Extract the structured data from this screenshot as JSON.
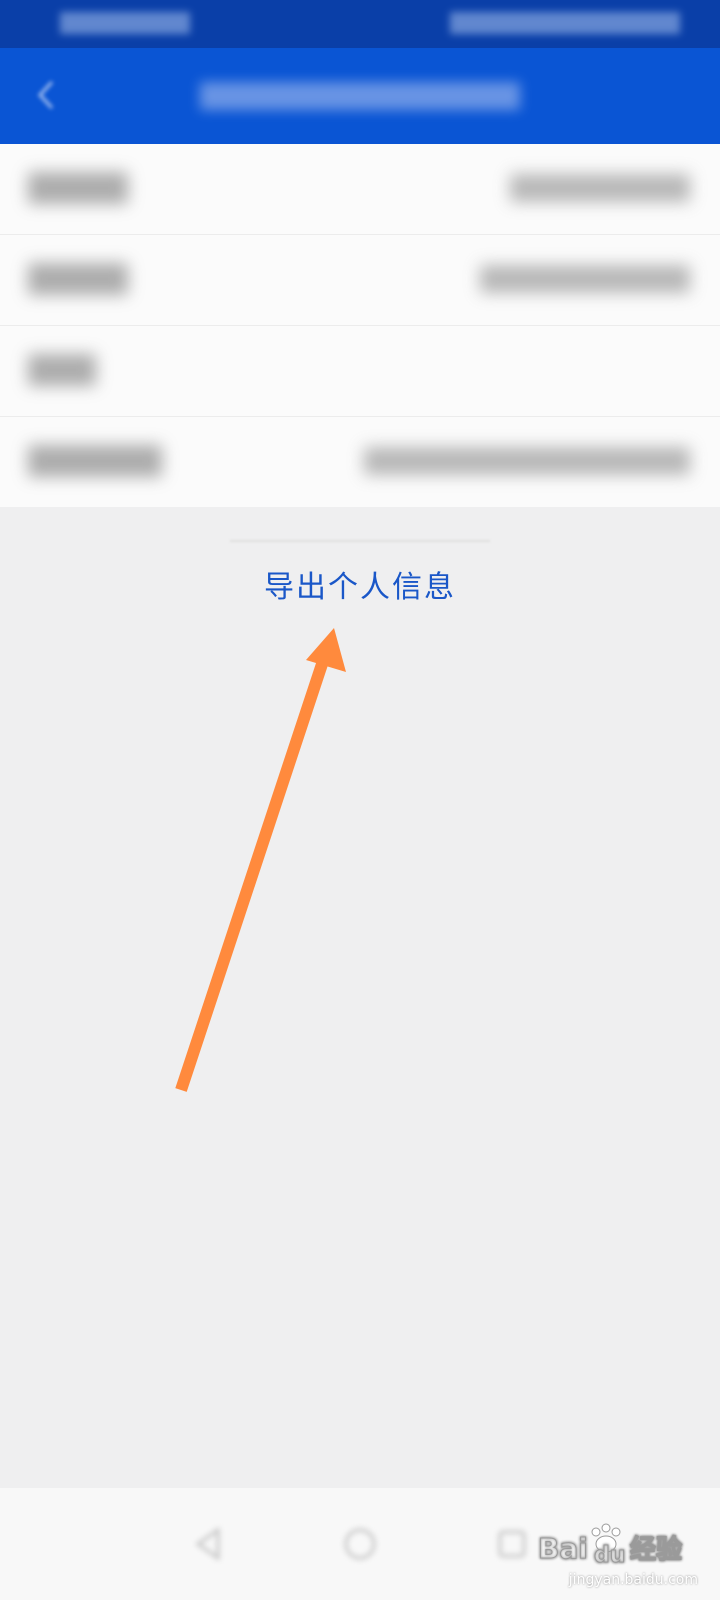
{
  "actions": {
    "export_label": "导出个人信息"
  },
  "annotation": {
    "color": "#ff8a3d"
  },
  "watermark": {
    "brand": "Bai du 经验",
    "url": "jingyan.baidu.com"
  },
  "colors": {
    "status_bar": "#0a3fa8",
    "header": "#0a55d4",
    "link": "#1a57c8",
    "background": "#efeff0"
  },
  "icons": {
    "back": "chevron-left-icon",
    "nav_back": "triangle-back-icon",
    "nav_home": "circle-home-icon",
    "nav_recent": "square-recent-icon"
  }
}
